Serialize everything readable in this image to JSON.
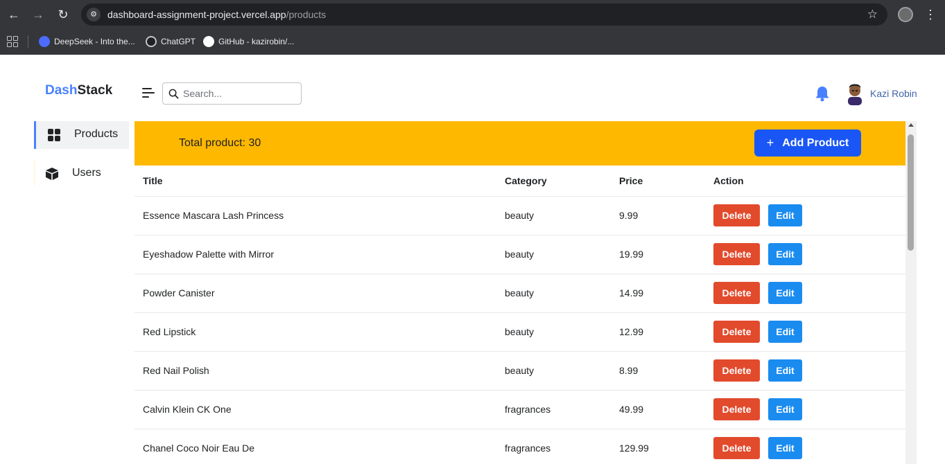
{
  "browser": {
    "url_host": "dashboard-assignment-project.vercel.app",
    "url_path": "/products",
    "bookmarks": [
      {
        "label": "DeepSeek - Into the...",
        "icon": "deepseek-icon"
      },
      {
        "label": "ChatGPT",
        "icon": "chatgpt-icon"
      },
      {
        "label": "GitHub - kazirobin/...",
        "icon": "github-icon"
      }
    ]
  },
  "app": {
    "logo_part1": "Dash",
    "logo_part2": "Stack",
    "accent_color": "#4880ff",
    "search_placeholder": "Search...",
    "user_name": "Kazi Robin"
  },
  "sidebar": {
    "items": [
      {
        "label": "Products",
        "icon": "grid-icon",
        "active": true
      },
      {
        "label": "Users",
        "icon": "cube-icon",
        "active": false
      }
    ]
  },
  "banner": {
    "total_label": "Total product: 30",
    "add_button": "Add Product",
    "background_color": "#ffb800"
  },
  "table": {
    "headers": [
      "Title",
      "Category",
      "Price",
      "Action"
    ],
    "rows": [
      {
        "title": "Essence Mascara Lash Princess",
        "category": "beauty",
        "price": "9.99"
      },
      {
        "title": "Eyeshadow Palette with Mirror",
        "category": "beauty",
        "price": "19.99"
      },
      {
        "title": "Powder Canister",
        "category": "beauty",
        "price": "14.99"
      },
      {
        "title": "Red Lipstick",
        "category": "beauty",
        "price": "12.99"
      },
      {
        "title": "Red Nail Polish",
        "category": "beauty",
        "price": "8.99"
      },
      {
        "title": "Calvin Klein CK One",
        "category": "fragrances",
        "price": "49.99"
      },
      {
        "title": "Chanel Coco Noir Eau De",
        "category": "fragrances",
        "price": "129.99"
      }
    ],
    "delete_label": "Delete",
    "edit_label": "Edit"
  }
}
